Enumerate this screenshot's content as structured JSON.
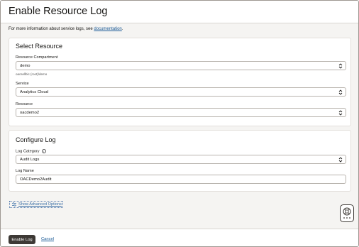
{
  "header": {
    "title": "Enable Resource Log"
  },
  "info": {
    "text": "For more information about service logs, see ",
    "link": "documentation",
    "suffix": "."
  },
  "select_resource": {
    "title": "Select Resource",
    "compartment": {
      "label": "Resource Compartment",
      "value": "demo",
      "hint": "oacsellbic (root)/demo"
    },
    "service": {
      "label": "Service",
      "value": "Analytics Cloud"
    },
    "resource": {
      "label": "Resource",
      "value": "oacdemo2"
    }
  },
  "configure_log": {
    "title": "Configure Log",
    "category": {
      "label": "Log Category",
      "value": "Audit Logs",
      "info_icon": "info-icon"
    },
    "name": {
      "label": "Log Name",
      "value": "OACDemo2Audit"
    }
  },
  "advanced": {
    "label": "Show Advanced Options",
    "icon": "sliders-icon"
  },
  "help": {
    "icon": "help-lifebuoy-icon"
  },
  "footer": {
    "primary": "Enable Log",
    "cancel": "Cancel"
  }
}
